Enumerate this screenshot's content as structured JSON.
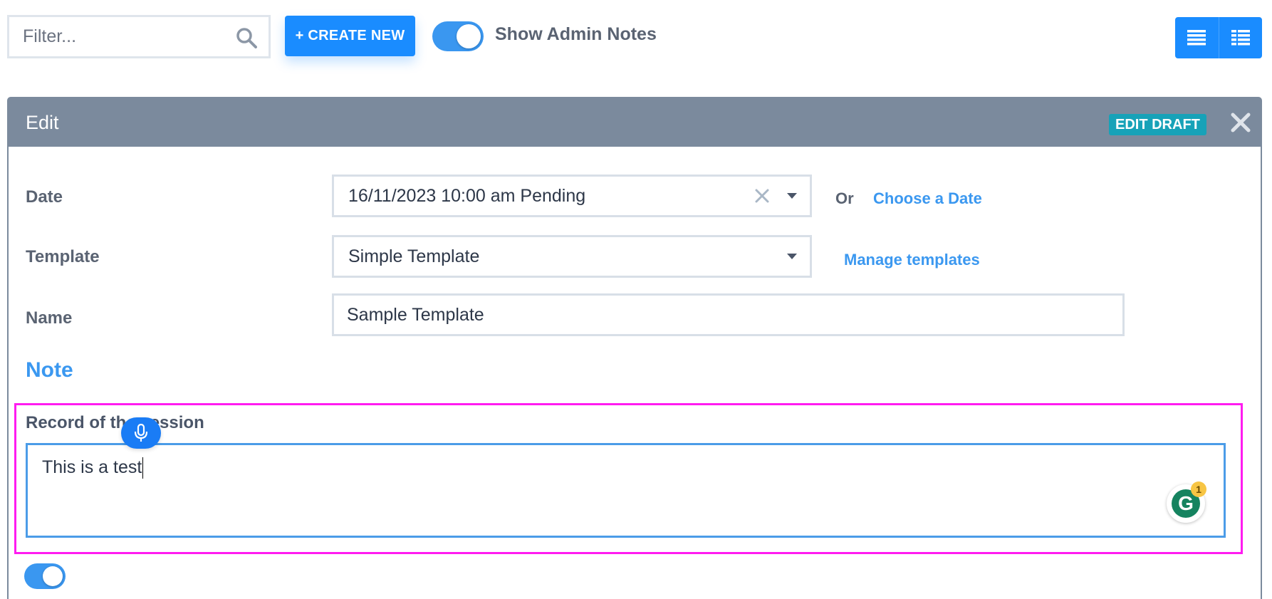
{
  "toolbar": {
    "filter_placeholder": "Filter...",
    "create_label": "+ CREATE NEW",
    "admin_notes_label": "Show Admin Notes",
    "admin_notes_on": true
  },
  "panel": {
    "title": "Edit",
    "badge": "EDIT DRAFT",
    "date": {
      "label": "Date",
      "value": "16/11/2023 10:00 am Pending",
      "or_text": "Or",
      "choose_link": "Choose a Date"
    },
    "template": {
      "label": "Template",
      "value": "Simple Template",
      "manage_link": "Manage templates"
    },
    "name": {
      "label": "Name",
      "value": "Sample Template"
    },
    "note_heading": "Note",
    "record": {
      "label": "Record of the session",
      "value": "This is a test"
    },
    "grammarly_count": "1",
    "bottom_toggle_on": true
  },
  "colors": {
    "accent": "#1a8cff",
    "header": "#7b8a9d",
    "badge": "#17a2b8",
    "highlight": "#ff1cf0",
    "link": "#3b98f0"
  }
}
